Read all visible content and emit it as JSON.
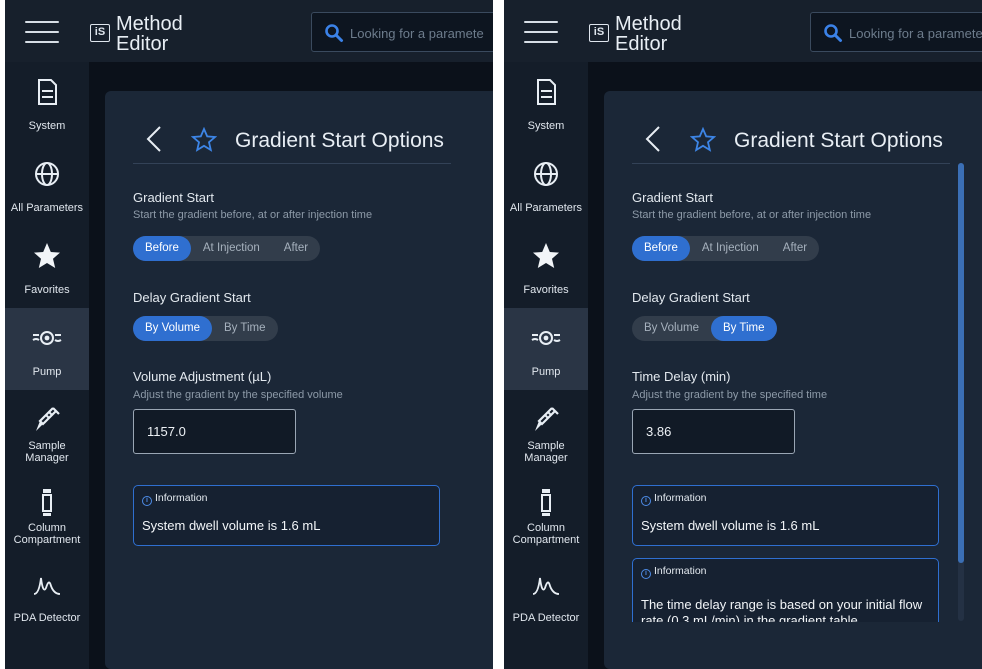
{
  "app": {
    "logo": "iS",
    "title_line1": "Method",
    "title_line2": "Editor",
    "search_placeholder": "Looking for a paramete"
  },
  "sidebar": {
    "items": [
      {
        "id": "system",
        "label": "System",
        "icon": "document-icon"
      },
      {
        "id": "all-parameters",
        "label": "All Parameters",
        "icon": "globe-icon"
      },
      {
        "id": "favorites",
        "label": "Favorites",
        "icon": "star-icon"
      },
      {
        "id": "pump",
        "label": "Pump",
        "icon": "pump-icon",
        "active": true
      },
      {
        "id": "sample-manager",
        "label_line1": "Sample",
        "label_line2": "Manager",
        "icon": "syringe-icon"
      },
      {
        "id": "column-compartment",
        "label_line1": "Column",
        "label_line2": "Compartment",
        "icon": "column-icon"
      },
      {
        "id": "pda-detector",
        "label": "PDA Detector",
        "icon": "chromatogram-icon"
      }
    ]
  },
  "panel_left": {
    "title": "Gradient Start Options",
    "gradient_start": {
      "title": "Gradient Start",
      "description": "Start the gradient before, at or after injection time",
      "options": [
        "Before",
        "At Injection",
        "After"
      ],
      "selected": "Before"
    },
    "delay": {
      "title": "Delay Gradient Start",
      "options": [
        "By Volume",
        "By Time"
      ],
      "selected": "By Volume"
    },
    "adjust": {
      "title": "Volume Adjustment (µL)",
      "description": "Adjust the gradient by the specified volume",
      "value": "1157.0"
    },
    "info": [
      {
        "heading": "Information",
        "body": "System dwell volume is 1.6 mL"
      }
    ]
  },
  "panel_right": {
    "title": "Gradient Start Options",
    "gradient_start": {
      "title": "Gradient Start",
      "description": "Start the gradient before, at or after injection time",
      "options": [
        "Before",
        "At Injection",
        "After"
      ],
      "selected": "Before"
    },
    "delay": {
      "title": "Delay Gradient Start",
      "options": [
        "By Volume",
        "By Time"
      ],
      "selected": "By Time"
    },
    "adjust": {
      "title": "Time Delay (min)",
      "description": "Adjust the gradient by the specified time",
      "value": "3.86"
    },
    "info": [
      {
        "heading": "Information",
        "body": "System dwell volume is 1.6 mL"
      },
      {
        "heading": "Information",
        "body": "The time delay range is based on your initial flow rate (0.3 mL/min) in the gradient table"
      }
    ]
  },
  "colors": {
    "accent": "#2f6fd0",
    "background": "#0b111a",
    "card": "#1b2737",
    "sidebar": "#141d29",
    "active_nav": "#2a3545"
  }
}
